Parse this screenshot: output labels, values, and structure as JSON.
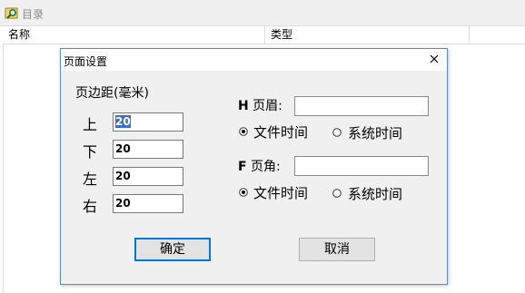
{
  "toolbar": {
    "label": "目录",
    "icon": "folder-search-icon"
  },
  "list": {
    "columns": [
      "名称",
      "类型",
      ""
    ]
  },
  "dialog": {
    "title": "页面设置",
    "margins_group_title": "页边距(毫米)",
    "margins": [
      {
        "label": "上",
        "value": "20"
      },
      {
        "label": "下",
        "value": "20"
      },
      {
        "label": "左",
        "value": "20"
      },
      {
        "label": "右",
        "value": "20"
      }
    ],
    "header": {
      "key": "H",
      "label": "页眉:",
      "value": "",
      "options": [
        {
          "label": "文件时间",
          "checked": true
        },
        {
          "label": "系统时间",
          "checked": false
        }
      ]
    },
    "footer": {
      "key": "F",
      "label": "页角:",
      "value": "",
      "options": [
        {
          "label": "文件时间",
          "checked": true
        },
        {
          "label": "系统时间",
          "checked": false
        }
      ]
    },
    "ok_label": "确定",
    "cancel_label": "取消"
  },
  "colors": {
    "dialog_border": "#5b8ec9",
    "selection": "#3a70c6",
    "default_button_border": "#0078d7"
  }
}
